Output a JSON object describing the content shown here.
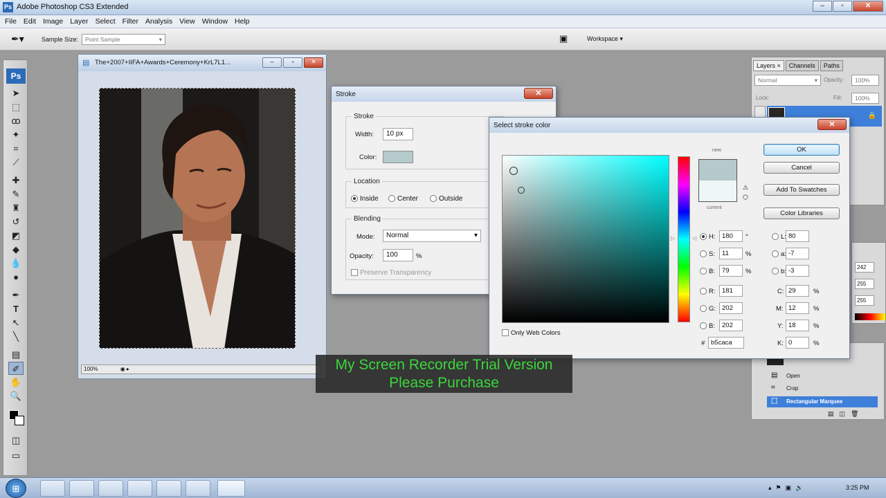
{
  "app": {
    "title": "Adobe Photoshop CS3 Extended",
    "logo": "Ps"
  },
  "menu": [
    "File",
    "Edit",
    "Image",
    "Layer",
    "Select",
    "Filter",
    "Analysis",
    "View",
    "Window",
    "Help"
  ],
  "options_bar": {
    "sample_size_label": "Sample Size:",
    "sample_size_value": "Point Sample",
    "workspace_label": "Workspace"
  },
  "toolbox": {
    "logo": "Ps"
  },
  "document": {
    "title": "The+2007+IIFA+Awards+Ceremony+KrL7L1...",
    "zoom": "100%"
  },
  "stroke_dialog": {
    "title": "Stroke",
    "stroke_group": "Stroke",
    "width_label": "Width:",
    "width_value": "10 px",
    "color_label": "Color:",
    "swatch_color": "#b5caca",
    "location_group": "Location",
    "location_options": [
      "Inside",
      "Center",
      "Outside"
    ],
    "location_selected": "Inside",
    "blending_group": "Blending",
    "mode_label": "Mode:",
    "mode_value": "Normal",
    "opacity_label": "Opacity:",
    "opacity_value": "100",
    "opacity_unit": "%",
    "preserve_label": "Preserve Transparency"
  },
  "color_picker": {
    "title": "Select stroke color",
    "ok": "OK",
    "cancel": "Cancel",
    "add_to_swatches": "Add To Swatches",
    "color_libraries": "Color Libraries",
    "new_label": "new",
    "current_label": "current",
    "new_color": "#b5caca",
    "current_color": "#eef6f6",
    "only_web_colors": "Only Web Colors",
    "H": "180",
    "H_unit": "°",
    "S": "11",
    "S_unit": "%",
    "B": "79",
    "B_unit": "%",
    "R": "181",
    "G": "202",
    "Bv": "202",
    "L": "80",
    "a": "-7",
    "b": "-3",
    "C": "29",
    "M": "12",
    "Y": "18",
    "K": "0",
    "pct": "%",
    "hex_label": "#",
    "hex": "b5caca",
    "field_hue": "#00ffff"
  },
  "layers_panel": {
    "tabs": [
      "Layers",
      "Channels",
      "Paths"
    ],
    "blend_mode": "Normal",
    "opacity_label": "Opacity:",
    "opacity_value": "100%",
    "lock_label": "Lock:",
    "fill_label": "Fill:",
    "fill_value": "100%"
  },
  "color_panel_values": [
    "242",
    "255",
    "255"
  ],
  "history_panel": {
    "items": [
      "Open",
      "Crop",
      "Rectangular Marquee"
    ]
  },
  "watermark": {
    "line1": "My Screen Recorder Trial Version",
    "line2": "Please Purchase"
  },
  "taskbar": {
    "time": "3:25 PM"
  }
}
